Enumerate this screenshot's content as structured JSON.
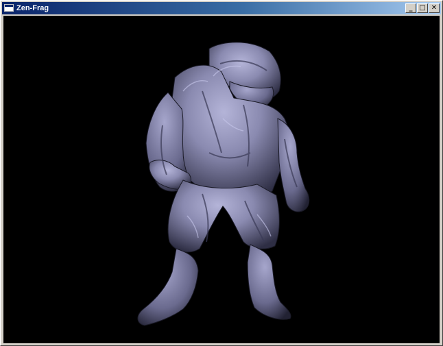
{
  "window": {
    "title": "Zen-Frag",
    "buttons": {
      "minimize": "_",
      "maximize": "□",
      "close": "✕"
    }
  },
  "viewport": {
    "background": "#000000",
    "model_color": "#8e8eb4"
  }
}
